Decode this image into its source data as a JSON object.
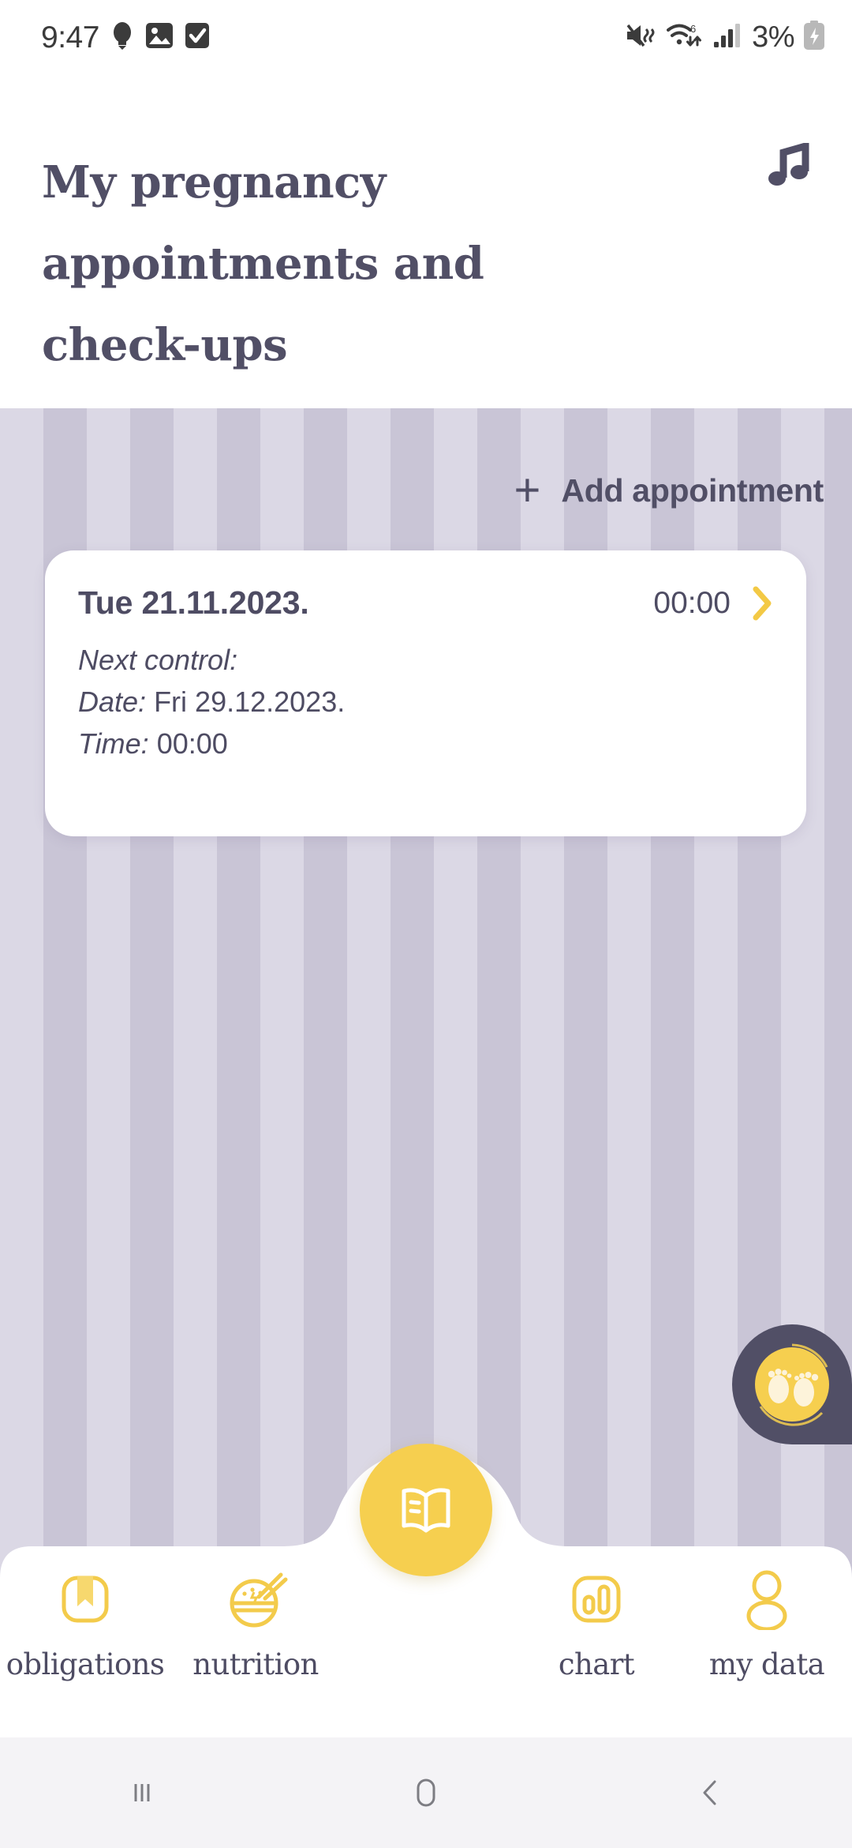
{
  "status_bar": {
    "time": "9:47",
    "battery_percent": "3%",
    "left_icons": [
      "bulb-icon",
      "image-icon",
      "checkbox-icon"
    ],
    "right_icons": [
      "mute-vibrate-icon",
      "wifi-6-icon",
      "signal-bars-icon",
      "battery-charging-icon"
    ]
  },
  "header": {
    "title": "My pregnancy appointments and check-ups",
    "action_icon": "music-note-icon"
  },
  "content": {
    "add_appointment": {
      "plus": "+",
      "label": "Add appointment"
    },
    "appointments": [
      {
        "date": "Tue 21.11.2023.",
        "time": "00:00",
        "chevron": "chevron-right-icon",
        "next_control_label": "Next control:",
        "date_label": "Date:",
        "date_value": "Fri 29.12.2023.",
        "time_label": "Time:",
        "time_value": "00:00"
      }
    ],
    "floating_button": {
      "icon": "baby-footprints-icon"
    }
  },
  "bottom_nav": {
    "items": [
      {
        "label": "obligations",
        "icon": "bookmark-icon"
      },
      {
        "label": "nutrition",
        "icon": "rice-bowl-icon"
      },
      {
        "label": "",
        "icon": "open-book-icon"
      },
      {
        "label": "chart",
        "icon": "bar-chart-icon"
      },
      {
        "label": "my data",
        "icon": "person-icon"
      }
    ],
    "center_icon": "open-book-icon"
  },
  "system_nav": {
    "buttons": [
      "recent-apps-icon",
      "home-icon",
      "back-icon"
    ]
  },
  "colors": {
    "accent_yellow": "#f6cf4f",
    "dark_purple": "#514f66",
    "stripe_light": "#dbd8e5",
    "stripe_dark": "#c9c5d6",
    "card_white": "#ffffff"
  }
}
